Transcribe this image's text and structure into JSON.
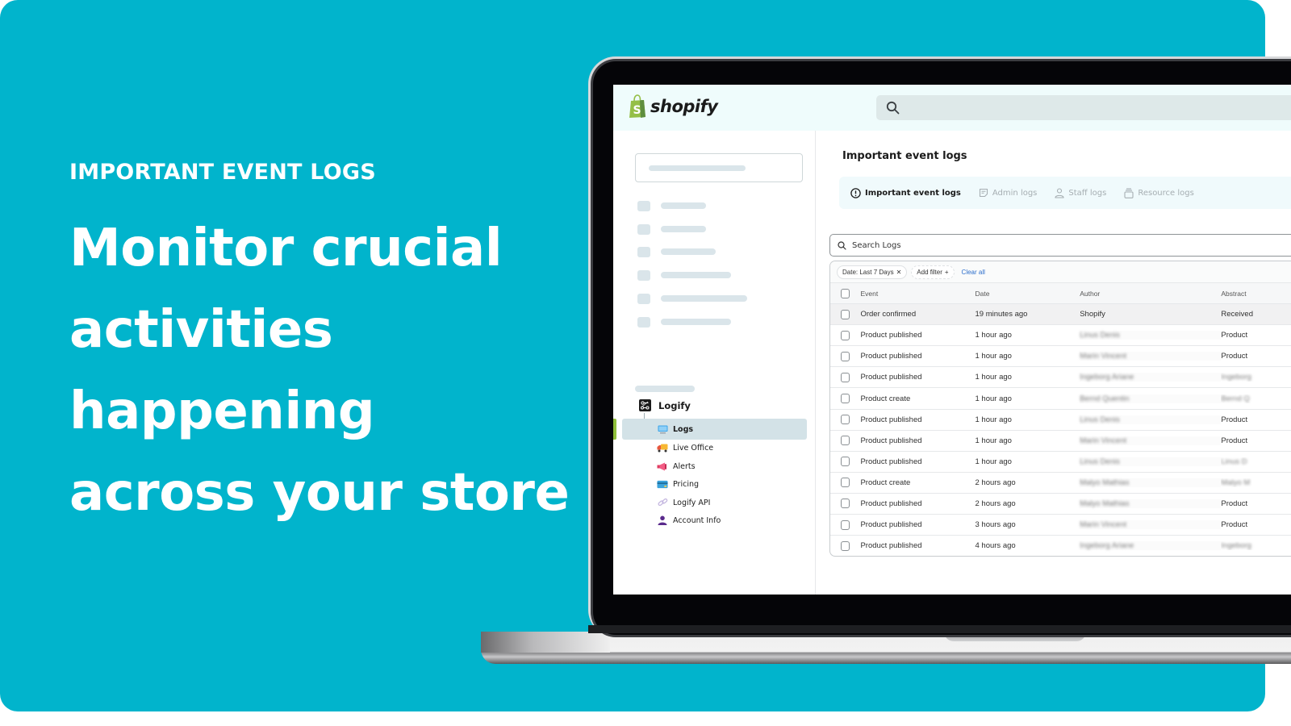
{
  "marketing": {
    "eyebrow": "IMPORTANT EVENT LOGS",
    "headline_lines": [
      "Monitor crucial",
      "activities",
      "happening",
      "across your store"
    ],
    "background_color": "#01b4cc"
  },
  "app": {
    "brand": "shopify",
    "brand_color": "#95bf47",
    "search_icon": "search-icon"
  },
  "sidebar": {
    "app_name": "Logify",
    "items": [
      {
        "label": "Logs",
        "icon": "computer-icon",
        "active": true
      },
      {
        "label": "Live Office",
        "icon": "truck-icon",
        "active": false
      },
      {
        "label": "Alerts",
        "icon": "megaphone-icon",
        "active": false
      },
      {
        "label": "Pricing",
        "icon": "credit-card-icon",
        "active": false
      },
      {
        "label": "Logify API",
        "icon": "link-icon",
        "active": false
      },
      {
        "label": "Account Info",
        "icon": "user-icon",
        "active": false
      }
    ]
  },
  "main": {
    "title": "Important event logs",
    "tabs": [
      {
        "label": "Important event logs",
        "icon": "alert-circle-icon",
        "active": true
      },
      {
        "label": "Admin logs",
        "icon": "note-icon",
        "active": false
      },
      {
        "label": "Staff logs",
        "icon": "person-icon",
        "active": false
      },
      {
        "label": "Resource logs",
        "icon": "archive-icon",
        "active": false
      }
    ],
    "search_placeholder": "Search Logs",
    "filters": {
      "date_chip": "Date: Last 7 Days",
      "add_filter": "Add filter",
      "clear_all": "Clear all"
    },
    "table": {
      "columns": [
        "Event",
        "Date",
        "Author",
        "Abstract"
      ],
      "rows": [
        {
          "event": "Order confirmed",
          "date": "19 minutes ago",
          "author": "Shopify",
          "abstract": "Received",
          "author_blurred": false,
          "abstract_blurred": false
        },
        {
          "event": "Product published",
          "date": "1 hour ago",
          "author": "Linus Denis",
          "abstract": "Product",
          "author_blurred": true,
          "abstract_blurred": false
        },
        {
          "event": "Product published",
          "date": "1 hour ago",
          "author": "Marin Vincent",
          "abstract": "Product",
          "author_blurred": true,
          "abstract_blurred": false
        },
        {
          "event": "Product published",
          "date": "1 hour ago",
          "author": "Ingeborg Ariane",
          "abstract": "Ingeborg",
          "author_blurred": true,
          "abstract_blurred": true
        },
        {
          "event": "Product create",
          "date": "1 hour ago",
          "author": "Bernd Quentin",
          "abstract": "Bernd Q",
          "author_blurred": true,
          "abstract_blurred": true
        },
        {
          "event": "Product published",
          "date": "1 hour ago",
          "author": "Linus Denis",
          "abstract": "Product",
          "author_blurred": true,
          "abstract_blurred": false
        },
        {
          "event": "Product published",
          "date": "1 hour ago",
          "author": "Marin Vincent",
          "abstract": "Product",
          "author_blurred": true,
          "abstract_blurred": false
        },
        {
          "event": "Product published",
          "date": "1 hour ago",
          "author": "Linus Denis",
          "abstract": "Linus D",
          "author_blurred": true,
          "abstract_blurred": true
        },
        {
          "event": "Product create",
          "date": "2 hours ago",
          "author": "Malyo Mathias",
          "abstract": "Malyo M",
          "author_blurred": true,
          "abstract_blurred": true
        },
        {
          "event": "Product published",
          "date": "2 hours ago",
          "author": "Malyo Mathias",
          "abstract": "Product",
          "author_blurred": true,
          "abstract_blurred": false
        },
        {
          "event": "Product published",
          "date": "3 hours ago",
          "author": "Marin Vincent",
          "abstract": "Product",
          "author_blurred": true,
          "abstract_blurred": false
        },
        {
          "event": "Product published",
          "date": "4 hours ago",
          "author": "Ingeborg Ariane",
          "abstract": "Ingeborg",
          "author_blurred": true,
          "abstract_blurred": true
        }
      ]
    }
  }
}
